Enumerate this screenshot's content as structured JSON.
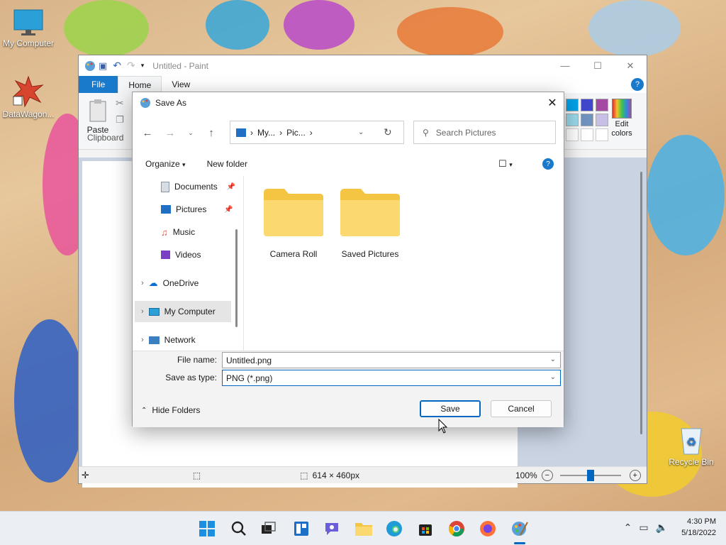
{
  "desktop": {
    "icons": [
      {
        "label": "My Computer",
        "icon": "monitor-icon"
      },
      {
        "label": "DataWagon...",
        "icon": "datawagon-icon"
      },
      {
        "label": "Recycle Bin",
        "icon": "recycle-bin-icon"
      }
    ]
  },
  "paint": {
    "title": "Untitled - Paint",
    "tabs": [
      "File",
      "Home",
      "View"
    ],
    "ribbon": {
      "paste_label": "Paste",
      "clipboard_label": "Clipboard",
      "edit_colors_label": "Edit colors"
    },
    "status": {
      "size": "614 × 460px",
      "zoom": "100%"
    },
    "zoom_level": 0.5,
    "palette": [
      "#00a2e8",
      "#3f48cc",
      "#a349a4",
      "#99d9ea",
      "#7092be",
      "#c8bfe7",
      "#ffffff",
      "#ffffff",
      "#ffffff"
    ]
  },
  "dialog": {
    "title": "Save As",
    "address": {
      "seg1": "My...",
      "seg2": "Pic..."
    },
    "search_placeholder": "Search Pictures",
    "organize_label": "Organize",
    "new_folder_label": "New folder",
    "sidebar": [
      {
        "label": "Documents",
        "icon": "documents-icon",
        "pinned": true
      },
      {
        "label": "Pictures",
        "icon": "pictures-icon",
        "pinned": true
      },
      {
        "label": "Music",
        "icon": "music-icon",
        "pinned": false
      },
      {
        "label": "Videos",
        "icon": "videos-icon",
        "pinned": false
      },
      {
        "label": "OneDrive",
        "icon": "onedrive-icon",
        "expandable": true
      },
      {
        "label": "My Computer",
        "icon": "computer-icon",
        "expandable": true,
        "selected": true
      },
      {
        "label": "Network",
        "icon": "network-icon",
        "expandable": true
      }
    ],
    "folders": [
      "Camera Roll",
      "Saved Pictures"
    ],
    "file_name_label": "File name:",
    "file_name_value": "Untitled.png",
    "save_type_label": "Save as type:",
    "save_type_value": "PNG (*.png)",
    "hide_folders_label": "Hide Folders",
    "save_label": "Save",
    "cancel_label": "Cancel"
  },
  "taskbar": {
    "apps": [
      "start-icon",
      "search-icon",
      "task-view-icon",
      "widgets-icon",
      "chat-icon",
      "file-explorer-icon",
      "edge-icon",
      "store-icon",
      "chrome-icon",
      "firefox-icon",
      "paint-icon"
    ],
    "time": "4:30 PM",
    "date": "5/18/2022"
  }
}
